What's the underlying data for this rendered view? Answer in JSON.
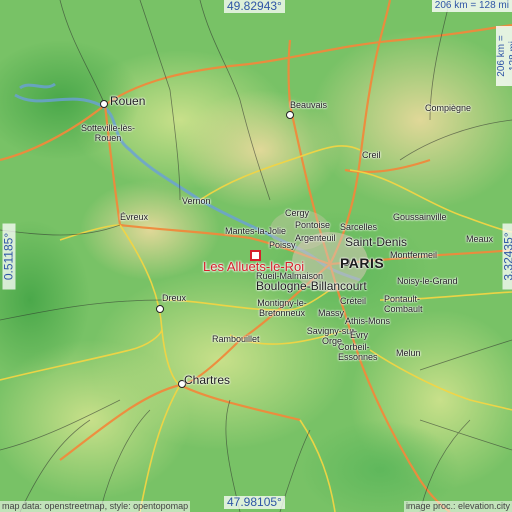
{
  "coords": {
    "top": "49.82943°",
    "bottom": "47.98105°",
    "left": "0.51185°",
    "right": "3.32435°"
  },
  "scale": {
    "horizontal": "206 km = 128 mi",
    "vertical": "206 km = 128 mi"
  },
  "attribution": {
    "left": "map data: openstreetmap, style: opentopomap",
    "right": "image proc.: elevation.city"
  },
  "focus": "Les Alluets-le-Roi",
  "places": {
    "rouen": "Rouen",
    "sotteville": "Sotteville-lès-\nRouen",
    "beauvais": "Beauvais",
    "compiegne": "Compiègne",
    "creil": "Creil",
    "vernon": "Vernon",
    "evreux": "Évreux",
    "mantes": "Mantes-la-Jolie",
    "cergy": "Cergy",
    "pontoise": "Pontoise",
    "sarcelles": "Sarcelles",
    "goussainville": "Goussainville",
    "poissy": "Poissy",
    "argenteuil": "Argenteuil",
    "saintdenis": "Saint-Denis",
    "meaux": "Meaux",
    "montfermeil": "Montfermeil",
    "paris": "PARIS",
    "rueil": "Rueil-Malmaison",
    "boulogne": "Boulogne-Billancourt",
    "noisy": "Noisy-le-Grand",
    "dreux": "Dreux",
    "montigny": "Montigny-le-\nBretonneux",
    "creteil": "Créteil",
    "pontault": "Pontault-\nCombault",
    "massy": "Massy",
    "athis": "Athis-Mons",
    "savigny": "Savigny-sur-\nOrge",
    "evry": "Évry",
    "rambouillet": "Rambouillet",
    "corbeil": "Corbeil-\nEssonnes",
    "melun": "Melun",
    "chartres": "Chartres"
  }
}
